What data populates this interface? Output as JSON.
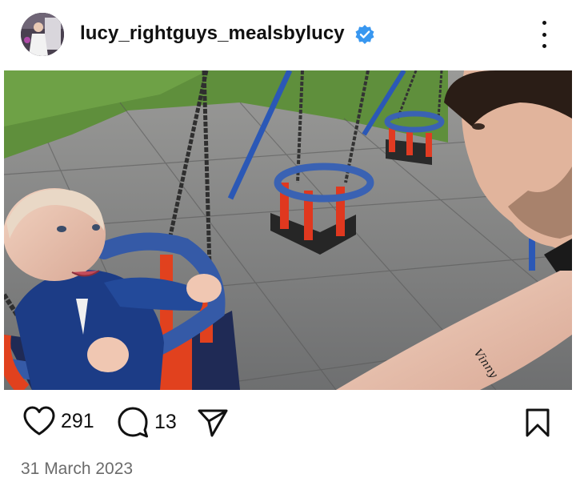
{
  "post": {
    "username": "lucy_rightguys_mealsbylucy",
    "verified": true,
    "likes": "291",
    "comments": "13",
    "date": "31 March 2023",
    "photo_tattoo_text": "Vinny"
  },
  "icons": {
    "avatar": "profile-avatar",
    "verified": "verified-badge-icon",
    "more": "more-options-icon",
    "like": "heart-icon",
    "comment": "comment-bubble-icon",
    "share": "paper-plane-icon",
    "save": "bookmark-icon"
  },
  "colors": {
    "verified_blue": "#3897f0",
    "text_primary": "#111111",
    "text_secondary": "#6b6b6b"
  }
}
